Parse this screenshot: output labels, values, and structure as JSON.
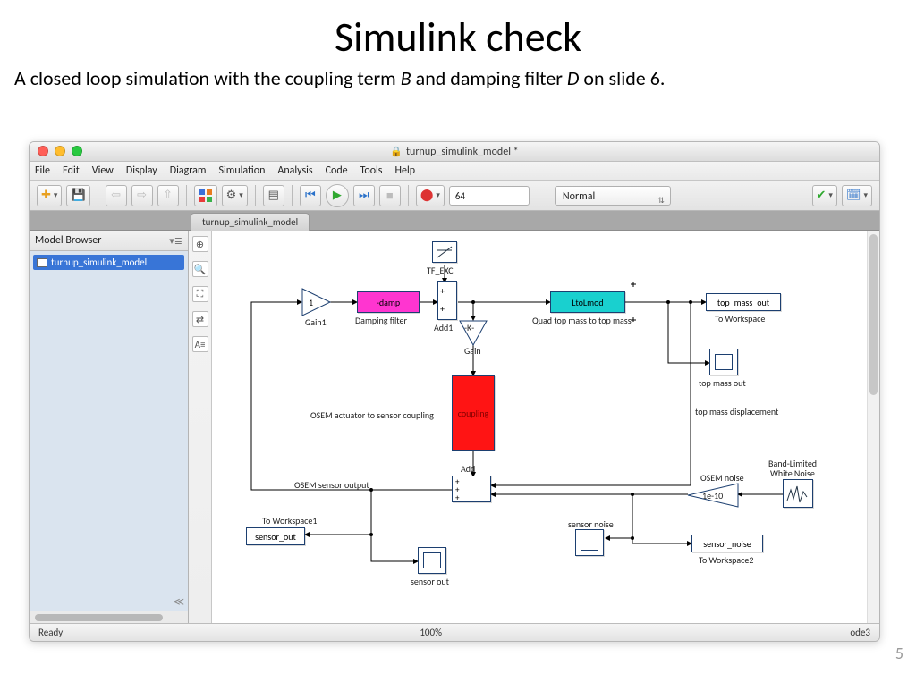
{
  "slide": {
    "title": "Simulink check",
    "subtitle_pre": "A closed loop simulation with the coupling term ",
    "subtitle_B": "B",
    "subtitle_mid": " and damping filter ",
    "subtitle_D": "D",
    "subtitle_post": " on slide 6.",
    "pagenum": "5"
  },
  "window": {
    "title": "turnup_simulink_model *",
    "menus": [
      "File",
      "Edit",
      "View",
      "Display",
      "Diagram",
      "Simulation",
      "Analysis",
      "Code",
      "Tools",
      "Help"
    ],
    "stoptime": "64",
    "simmode": "Normal",
    "tab": "turnup_simulink_model",
    "browser_title": "Model Browser",
    "browser_item": "turnup_simulink_model",
    "status_left": "Ready",
    "status_mid": "100%",
    "status_right": "ode3"
  },
  "blocks": {
    "tf_exc": "TF_EXC",
    "gain1label": "Gain1",
    "gain1": "1",
    "damp": "-damp",
    "damping_filter": "Damping filter",
    "add1": "Add1",
    "gainK_label": "Gain",
    "gainK": "-K-",
    "ltol": "LtoLmod",
    "quad_label": "Quad top mass to top mass",
    "top_mass_out": "top_mass_out",
    "to_workspace": "To Workspace",
    "top_mass_out2": "top mass out",
    "top_disp": "top mass displacement",
    "coupling": "coupling",
    "osem_actuator": "OSEM actuator to sensor coupling",
    "add": "Add",
    "osem_sensor": "OSEM sensor output",
    "to_workspace1": "To Workspace1",
    "sensor_out": "sensor_out",
    "sensor_out2": "sensor out",
    "osem_noise": "OSEM noise",
    "gain_noise": "1e-10",
    "bandnoise1": "Band-Limited",
    "bandnoise2": "White Noise",
    "sensor_noise": "sensor noise",
    "sensor_noise_ws": "sensor_noise",
    "to_workspace2": "To Workspace2"
  }
}
